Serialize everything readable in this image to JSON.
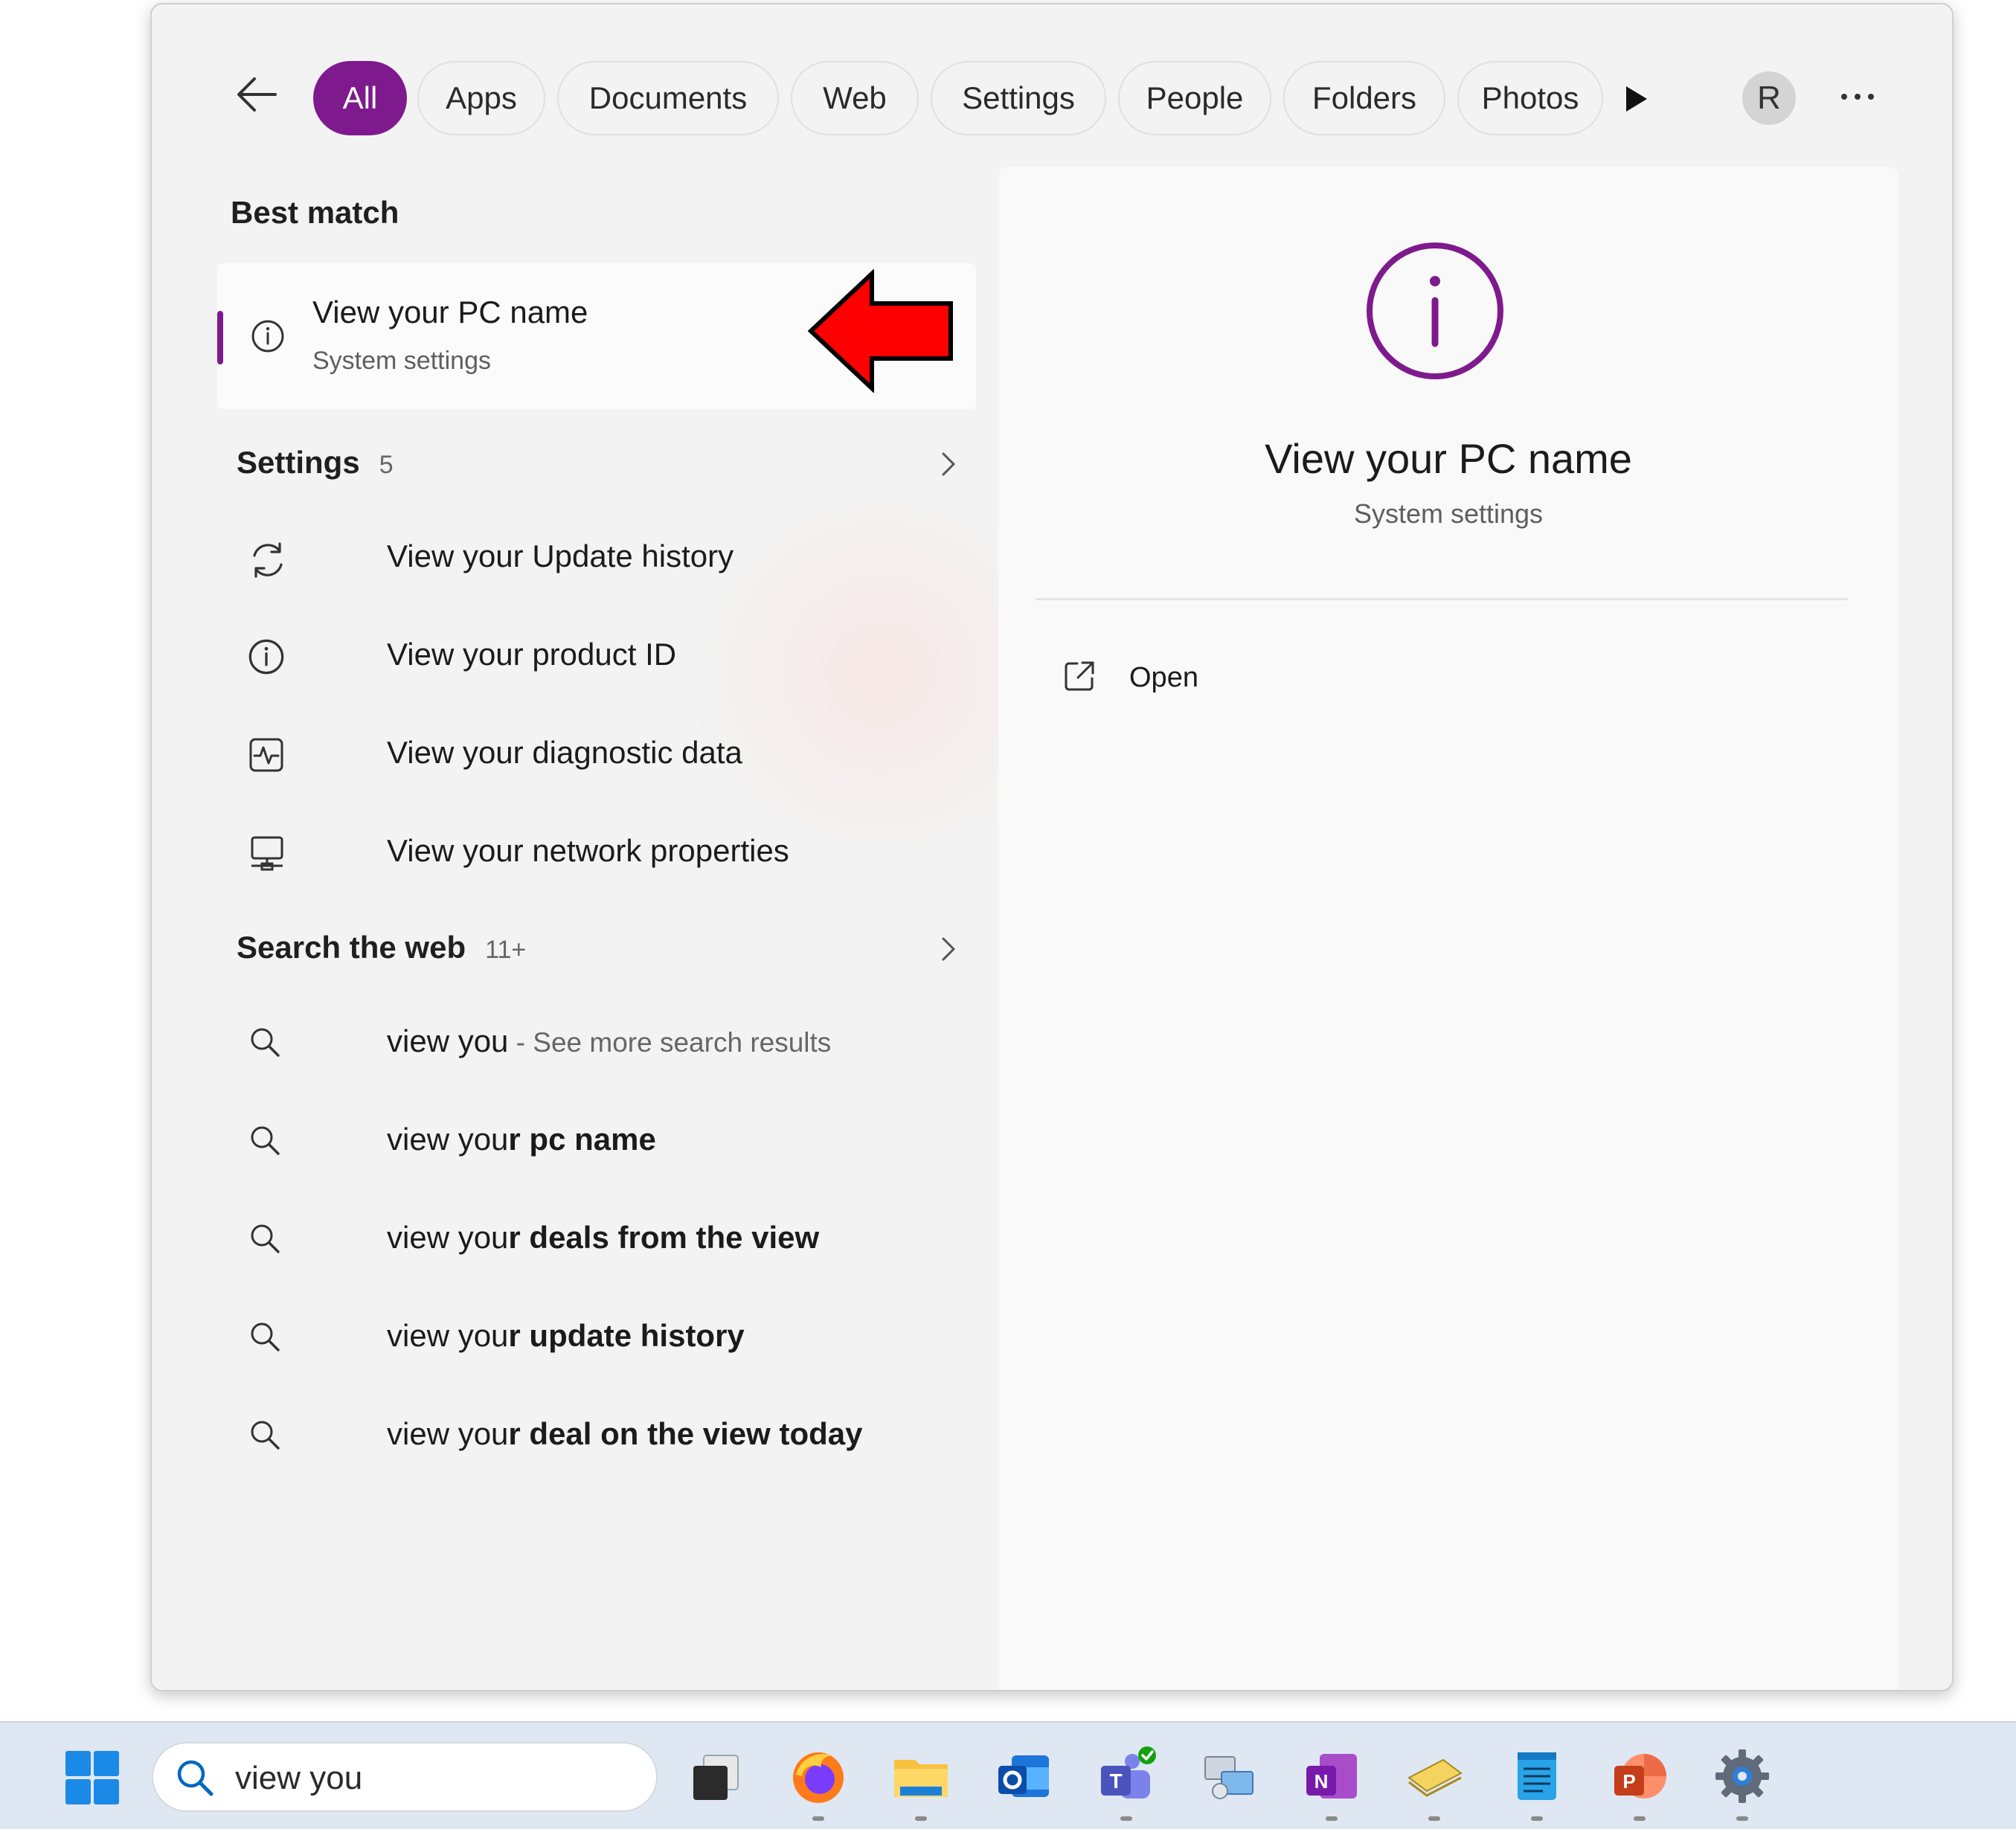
{
  "filters": {
    "tabs": [
      {
        "label": "All",
        "active": true
      },
      {
        "label": "Apps"
      },
      {
        "label": "Documents"
      },
      {
        "label": "Web"
      },
      {
        "label": "Settings"
      },
      {
        "label": "People"
      },
      {
        "label": "Folders"
      },
      {
        "label": "Photos"
      }
    ],
    "avatar_initial": "R",
    "icons": {
      "back": "back-arrow-icon",
      "more_filters": "play-icon",
      "overflow": "more-horizontal-icon"
    }
  },
  "best_match": {
    "heading": "Best match",
    "title": "View your PC name",
    "subtitle": "System settings",
    "icon": "info-icon"
  },
  "settings_section": {
    "heading": "Settings",
    "count": "5",
    "items": [
      {
        "label": "View your Update history",
        "icon": "sync-icon"
      },
      {
        "label": "View your product ID",
        "icon": "info-icon"
      },
      {
        "label": "View your diagnostic data",
        "icon": "diagnostic-icon"
      },
      {
        "label": "View your network properties",
        "icon": "network-pc-icon"
      }
    ]
  },
  "web_section": {
    "heading": "Search the web",
    "count": "11+",
    "items": [
      {
        "prefix": "view you",
        "suffix": " - See more search results"
      },
      {
        "prefix": "view you",
        "bold": "r pc name"
      },
      {
        "prefix": "view you",
        "bold": "r deals from the view"
      },
      {
        "prefix": "view you",
        "bold": "r update history"
      },
      {
        "prefix": "view you",
        "bold": "r deal on the view today"
      }
    ]
  },
  "preview": {
    "title": "View your PC name",
    "subtitle": "System settings",
    "action_open": "Open",
    "icon": "info-icon"
  },
  "taskbar": {
    "search_value": "view you",
    "apps": [
      "windows-start-icon",
      "task-view-icon",
      "firefox-icon",
      "file-explorer-icon",
      "outlook-icon",
      "teams-icon",
      "remote-desktop-icon",
      "onenote-icon",
      "sticky-notes-icon",
      "notepad-icon",
      "powerpoint-icon",
      "settings-gear-icon"
    ]
  },
  "colors": {
    "accent": "#7e1a8d",
    "annotation_arrow": "#ff0000"
  }
}
